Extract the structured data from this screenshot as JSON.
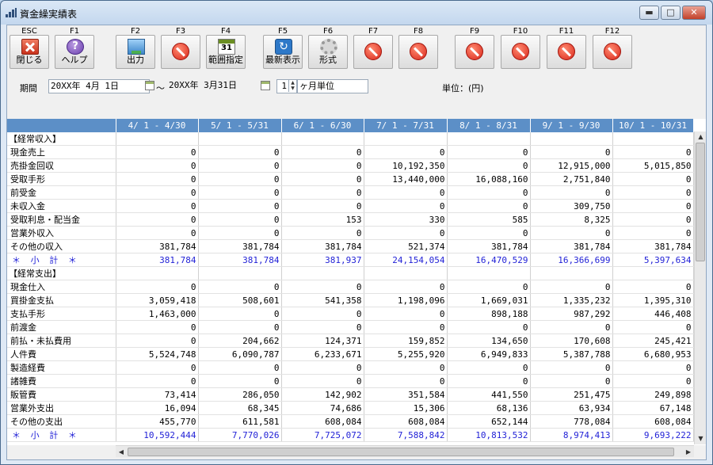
{
  "window": {
    "title": "資金繰実績表",
    "controls": {
      "minimize": "▬",
      "maximize": "□",
      "close": "✕"
    }
  },
  "toolbar": [
    {
      "key": "ESC",
      "label": "閉じる",
      "icon": "close-icon"
    },
    {
      "key": "F1",
      "label": "ヘルプ",
      "icon": "help-icon"
    },
    {
      "key": "F2",
      "label": "出力",
      "icon": "output-icon"
    },
    {
      "key": "F3",
      "label": "",
      "icon": "disabled-icon"
    },
    {
      "key": "F4",
      "label": "範囲指定",
      "icon": "calendar-icon",
      "icon_text": "31"
    },
    {
      "key": "F5",
      "label": "最新表示",
      "icon": "refresh-icon"
    },
    {
      "key": "F6",
      "label": "形式",
      "icon": "gear-icon"
    },
    {
      "key": "F7",
      "label": "",
      "icon": "disabled-icon"
    },
    {
      "key": "F8",
      "label": "",
      "icon": "disabled-icon"
    },
    {
      "key": "F9",
      "label": "",
      "icon": "disabled-icon"
    },
    {
      "key": "F10",
      "label": "",
      "icon": "disabled-icon"
    },
    {
      "key": "F11",
      "label": "",
      "icon": "disabled-icon"
    },
    {
      "key": "F12",
      "label": "",
      "icon": "disabled-icon"
    }
  ],
  "period": {
    "label": "期間",
    "start": "20XX年 4月 1日",
    "separator": "～",
    "end": "20XX年 3月31日",
    "step_value": "1",
    "step_unit": "ヶ月単位",
    "unit_label": "単位：(円)"
  },
  "table": {
    "columns": [
      "",
      "4/ 1 - 4/30",
      "5/ 1 - 5/31",
      "6/ 1 - 6/30",
      "7/ 1 - 7/31",
      "8/ 1 - 8/31",
      "9/ 1 - 9/30",
      "10/ 1 - 10/31"
    ],
    "rows": [
      {
        "type": "section",
        "name": "【経常収入】",
        "values": [
          "",
          "",
          "",
          "",
          "",
          "",
          ""
        ]
      },
      {
        "type": "item",
        "name": "現金売上",
        "values": [
          "0",
          "0",
          "0",
          "0",
          "0",
          "0",
          "0"
        ]
      },
      {
        "type": "item",
        "name": "売掛金回収",
        "values": [
          "0",
          "0",
          "0",
          "10,192,350",
          "0",
          "12,915,000",
          "5,015,850"
        ]
      },
      {
        "type": "item",
        "name": "受取手形",
        "values": [
          "0",
          "0",
          "0",
          "13,440,000",
          "16,088,160",
          "2,751,840",
          "0"
        ]
      },
      {
        "type": "item",
        "name": "前受金",
        "values": [
          "0",
          "0",
          "0",
          "0",
          "0",
          "0",
          "0"
        ]
      },
      {
        "type": "item",
        "name": "未収入金",
        "values": [
          "0",
          "0",
          "0",
          "0",
          "0",
          "309,750",
          "0"
        ]
      },
      {
        "type": "item",
        "name": "受取利息・配当金",
        "values": [
          "0",
          "0",
          "153",
          "330",
          "585",
          "8,325",
          "0"
        ]
      },
      {
        "type": "item",
        "name": "営業外収入",
        "values": [
          "0",
          "0",
          "0",
          "0",
          "0",
          "0",
          "0"
        ]
      },
      {
        "type": "item",
        "name": "その他の収入",
        "values": [
          "381,784",
          "381,784",
          "381,784",
          "521,374",
          "381,784",
          "381,784",
          "381,784"
        ]
      },
      {
        "type": "subtotal",
        "name": "＊ 小 計 ＊",
        "values": [
          "381,784",
          "381,784",
          "381,937",
          "24,154,054",
          "16,470,529",
          "16,366,699",
          "5,397,634"
        ]
      },
      {
        "type": "section",
        "name": "【経常支出】",
        "values": [
          "",
          "",
          "",
          "",
          "",
          "",
          ""
        ]
      },
      {
        "type": "item",
        "name": "現金仕入",
        "values": [
          "0",
          "0",
          "0",
          "0",
          "0",
          "0",
          "0"
        ]
      },
      {
        "type": "item",
        "name": "買掛金支払",
        "values": [
          "3,059,418",
          "508,601",
          "541,358",
          "1,198,096",
          "1,669,031",
          "1,335,232",
          "1,395,310"
        ]
      },
      {
        "type": "item",
        "name": "支払手形",
        "values": [
          "1,463,000",
          "0",
          "0",
          "0",
          "898,188",
          "987,292",
          "446,408"
        ]
      },
      {
        "type": "item",
        "name": "前渡金",
        "values": [
          "0",
          "0",
          "0",
          "0",
          "0",
          "0",
          "0"
        ]
      },
      {
        "type": "item",
        "name": "前払・未払費用",
        "values": [
          "0",
          "204,662",
          "124,371",
          "159,852",
          "134,650",
          "170,608",
          "245,421"
        ]
      },
      {
        "type": "item",
        "name": "人件費",
        "values": [
          "5,524,748",
          "6,090,787",
          "6,233,671",
          "5,255,920",
          "6,949,833",
          "5,387,788",
          "6,680,953"
        ]
      },
      {
        "type": "item",
        "name": "製造経費",
        "values": [
          "0",
          "0",
          "0",
          "0",
          "0",
          "0",
          "0"
        ]
      },
      {
        "type": "item",
        "name": "諸雑費",
        "values": [
          "0",
          "0",
          "0",
          "0",
          "0",
          "0",
          "0"
        ]
      },
      {
        "type": "item",
        "name": "販管費",
        "values": [
          "73,414",
          "286,050",
          "142,902",
          "351,584",
          "441,550",
          "251,475",
          "249,898"
        ]
      },
      {
        "type": "item",
        "name": "営業外支出",
        "values": [
          "16,094",
          "68,345",
          "74,686",
          "15,306",
          "68,136",
          "63,934",
          "67,148"
        ]
      },
      {
        "type": "item",
        "name": "その他の支出",
        "values": [
          "455,770",
          "611,581",
          "608,084",
          "608,084",
          "652,144",
          "778,084",
          "608,084"
        ]
      },
      {
        "type": "subtotal",
        "name": "＊ 小 計 ＊",
        "values": [
          "10,592,444",
          "7,770,026",
          "7,725,072",
          "7,588,842",
          "10,813,532",
          "8,974,413",
          "9,693,222"
        ]
      }
    ]
  },
  "colors": {
    "header_bg": "#5c8fc7",
    "subtotal_text": "#1f1fd6"
  }
}
